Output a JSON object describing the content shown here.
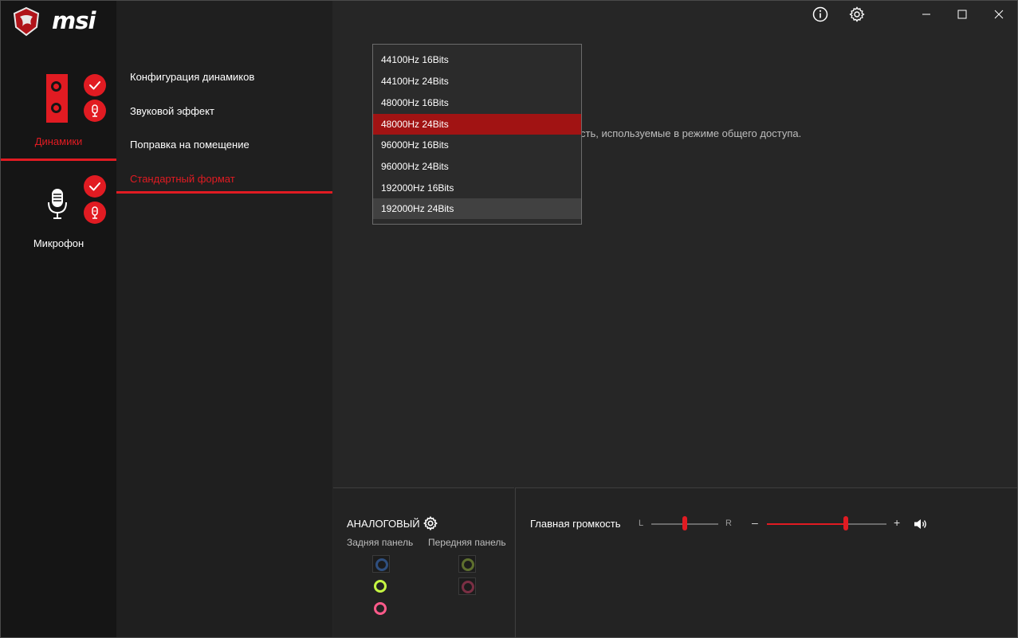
{
  "app": {
    "brand": "msi"
  },
  "devices": {
    "speakers_label": "Динамики",
    "mic_label": "Микрофон"
  },
  "menu": {
    "items": [
      {
        "label": "Конфигурация динамиков"
      },
      {
        "label": "Звуковой эффект"
      },
      {
        "label": "Поправка на помещение"
      },
      {
        "label": "Стандартный формат"
      }
    ],
    "active_index": 3
  },
  "content": {
    "description_visible": "сть, используемые в режиме общего доступа."
  },
  "dropdown": {
    "options": [
      "44100Hz 16Bits",
      "44100Hz 24Bits",
      "48000Hz 16Bits",
      "48000Hz 24Bits",
      "96000Hz 16Bits",
      "96000Hz 24Bits",
      "192000Hz 16Bits",
      "192000Hz 24Bits"
    ],
    "selected": "48000Hz 24Bits",
    "hovered": "192000Hz 24Bits"
  },
  "analog": {
    "title": "АНАЛОГОВЫЙ",
    "rear_label": "Задняя панель",
    "front_label": "Передняя панель",
    "rear_jacks": [
      {
        "color": "#2f4f7f",
        "dim": true
      },
      {
        "color": "#c5f542",
        "dim": false
      },
      {
        "color": "#ff5a8a",
        "dim": false
      }
    ],
    "front_jacks": [
      {
        "color": "#5e6f2e",
        "dim": true
      },
      {
        "color": "#7a2f44",
        "dim": true
      }
    ]
  },
  "volume": {
    "label": "Главная громкость",
    "left": "L",
    "right": "R",
    "minus": "–",
    "plus": "+",
    "balance_fraction": 0.5,
    "master_fraction": 0.66
  },
  "colors": {
    "accent": "#e11b22",
    "selected_bg": "#a11313"
  }
}
